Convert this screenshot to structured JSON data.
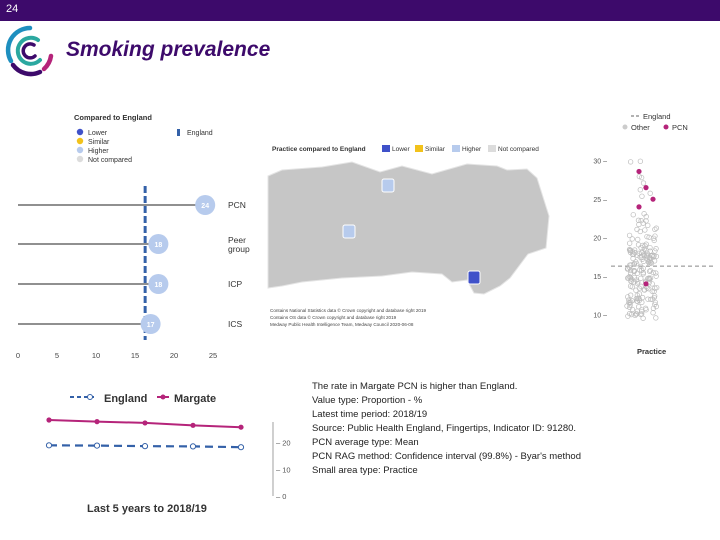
{
  "slide": {
    "number": "24",
    "title": "Smoking prevalence"
  },
  "colors": {
    "brand": "#3d0a6b",
    "lower": "#3f51c9",
    "similar": "#f2c21b",
    "higher": "#b7cbed",
    "not_compared": "#dcdcdc",
    "pcn": "#b5247a",
    "england": "#3461a8"
  },
  "chart_data": [
    {
      "type": "bar",
      "title": "Compared to England",
      "legend": {
        "title": "Compared to England",
        "items": [
          "Lower",
          "Similar",
          "Higher",
          "Not compared"
        ],
        "line_label": "England",
        "placement": "top-left"
      },
      "categories": [
        "PCN",
        "Peer group",
        "ICP",
        "ICS"
      ],
      "values": [
        24,
        18,
        18,
        17
      ],
      "value_labels": [
        "24",
        "18",
        "18",
        "17"
      ],
      "comparison": [
        "Higher",
        "Higher",
        "Higher",
        "Higher"
      ],
      "england_value": 16.3,
      "xlim": [
        0,
        25
      ],
      "xticks": [
        "0",
        "5",
        "10",
        "15",
        "20",
        "25"
      ]
    },
    {
      "type": "map",
      "legend_title": "Practice compared to England",
      "legend_items": [
        "Lower",
        "Similar",
        "Higher",
        "Not compared"
      ],
      "markers": [
        "Higher",
        "Higher",
        "Lower"
      ],
      "attribution": [
        "Contains National Statistics data © Crown copyright and database right 2019",
        "Contains OS data © Crown copyright and database right 2019",
        "Medway Public Health Intelligence Team, Medway Council 2020-06-08"
      ]
    },
    {
      "type": "scatter",
      "xlabel": "Practice",
      "legend": {
        "items": [
          "England",
          "Other",
          "PCN"
        ],
        "placement": "top-right"
      },
      "ylim": [
        8,
        31
      ],
      "yticks": [
        10,
        15,
        20,
        25,
        30
      ],
      "england_value": 16.3,
      "pcn_values": [
        28.6,
        26.5,
        25.0,
        24.0,
        14.0
      ]
    },
    {
      "type": "line",
      "title": "Last 5 years to 2018/19",
      "series": [
        {
          "name": "England",
          "values": [
            19.0,
            18.9,
            18.7,
            18.6,
            18.3
          ]
        },
        {
          "name": "Margate",
          "values": [
            28.5,
            27.9,
            27.4,
            26.5,
            25.8
          ]
        }
      ],
      "yticks": [
        "0",
        "10",
        "20"
      ],
      "ylim": [
        0,
        30
      ]
    }
  ],
  "info": {
    "lines": [
      "The rate in Margate PCN is higher than England.",
      "Value type: Proportion - %",
      "Latest time period: 2018/19",
      "Source: Public Health England, Fingertips, Indicator ID: 91280.",
      "PCN average type: Mean",
      "PCN RAG method: Confidence interval (99.8%) - Byar's method",
      "Small area type: Practice"
    ]
  }
}
